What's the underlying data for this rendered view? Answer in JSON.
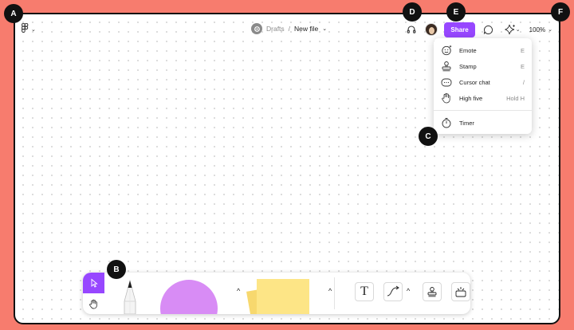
{
  "header": {
    "breadcrumb": {
      "folder": "Drafts",
      "separator": "/",
      "file": "New file",
      "caret": "⌄"
    },
    "share_label": "Share",
    "zoom": "100%",
    "caret": "⌄"
  },
  "actions_menu": {
    "items": [
      {
        "label": "Emote",
        "shortcut": "E",
        "icon": "emote-icon"
      },
      {
        "label": "Stamp",
        "shortcut": "E",
        "icon": "stamp-icon"
      },
      {
        "label": "Cursor chat",
        "shortcut": "/",
        "icon": "cursor-chat-icon"
      },
      {
        "label": "High five",
        "shortcut": "Hold H",
        "icon": "high-five-icon"
      }
    ],
    "timer": {
      "label": "Timer",
      "icon": "timer-icon"
    }
  },
  "markers": {
    "a": "A",
    "b": "B",
    "c": "C",
    "d": "D",
    "e": "E",
    "f": "F"
  },
  "toolbar": {
    "chevron": "^",
    "text_glyph": "T",
    "tools": [
      "move-tool",
      "hand-tool",
      "pencil-tool",
      "shape-tool",
      "sticky-tool",
      "text-tool",
      "connector-tool",
      "stamp-tool",
      "widget-tool"
    ]
  },
  "colors": {
    "accent": "#9747ff",
    "background": "#f77c6e",
    "shape": "#d88cf5",
    "sticky": "#fde586"
  }
}
